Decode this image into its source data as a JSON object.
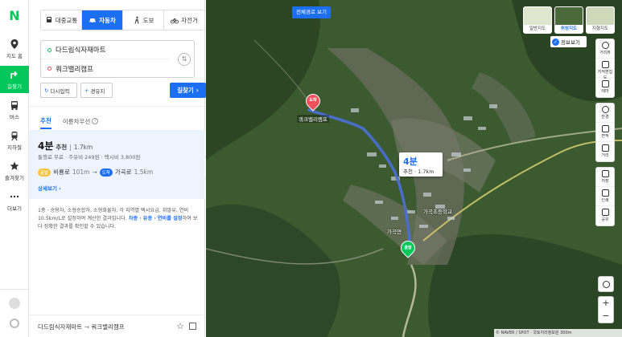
{
  "rail": {
    "logo": "N",
    "items": [
      {
        "label": "지도 홈",
        "icon": "map-pin-icon"
      },
      {
        "label": "길찾기",
        "icon": "directions-icon"
      },
      {
        "label": "버스",
        "icon": "bus-icon"
      },
      {
        "label": "지하철",
        "icon": "subway-icon"
      },
      {
        "label": "즐겨찾기",
        "icon": "star-icon"
      },
      {
        "label": "더보기",
        "icon": "more-icon"
      }
    ]
  },
  "modes": [
    {
      "label": "대중교통",
      "icon": "transit-icon"
    },
    {
      "label": "자동차",
      "icon": "car-icon"
    },
    {
      "label": "도보",
      "icon": "walk-icon"
    },
    {
      "label": "자전거",
      "icon": "bike-icon"
    }
  ],
  "route": {
    "origin": "다드림식자재마트",
    "destination": "쿼크밸리캠프"
  },
  "actions": {
    "reset": "다시입력",
    "waypoint": "경유지",
    "go": "길찾기"
  },
  "tabs": [
    {
      "label": "추천"
    },
    {
      "label": "이륜차우선"
    }
  ],
  "result": {
    "time": "4분",
    "tag": "추천",
    "distance": "1.7km",
    "fees": "통행료 무료 · 주유비 249원 · 택시비 3,800원",
    "road1_badge": "출발",
    "road1": "비룡로",
    "road1_dist": "101m",
    "road2_badge": "도착",
    "road2": "가곡로",
    "road2_dist": "1.5km",
    "more": "상세보기"
  },
  "notice_prefix": "1종 · 승용차, 소형승합차, 소형화물차, 각 지역별 택시요금, 휘발유, 연비 10.5km/L로 설정하여 계산한 결과입니다. ",
  "notice_link": "차종 · 유종 · 연비를 설정",
  "notice_suffix": "하여 보다 정확한 결과를 확인할 수 있습니다.",
  "footer": {
    "origin": "다드림식자재마트",
    "arrow": "→",
    "destination": "쿼크밸리캠프"
  },
  "map": {
    "full_route_btn": "전체경로 보기",
    "map_types": [
      {
        "label": "일반지도"
      },
      {
        "label": "위성지도"
      },
      {
        "label": "지형지도"
      }
    ],
    "info_btn": "정보보기",
    "tools1": [
      {
        "label": "거리뷰",
        "icon": "pin-icon"
      },
      {
        "label": "지적편집도",
        "icon": "grid-icon"
      },
      {
        "label": "테마",
        "icon": "layers-icon"
      }
    ],
    "tools2": [
      {
        "label": "반경",
        "icon": "radius-icon"
      },
      {
        "label": "면적",
        "icon": "area-icon"
      },
      {
        "label": "거리",
        "icon": "ruler-icon"
      }
    ],
    "tools3": [
      {
        "label": "저장",
        "icon": "save-icon"
      },
      {
        "label": "인쇄",
        "icon": "print-icon"
      },
      {
        "label": "공유",
        "icon": "share-icon"
      }
    ],
    "zoom_in": "+",
    "zoom_out": "−",
    "attribution": "© NAVER / SPOT · 국토지리정보원   300m",
    "callout_time": "4분",
    "callout_sub": "추천 · 1.7km",
    "dest_pin": "도착",
    "dest_name": "쿼크밸리캠프",
    "start_pin": "출발",
    "labels": {
      "school": "가곡초등학교",
      "office": "가곡면"
    }
  },
  "colors": {
    "brand_green": "#03c75a",
    "accent_blue": "#1d6ff2",
    "route_line": "#4a6fd1",
    "dest_red": "#f0505a"
  }
}
